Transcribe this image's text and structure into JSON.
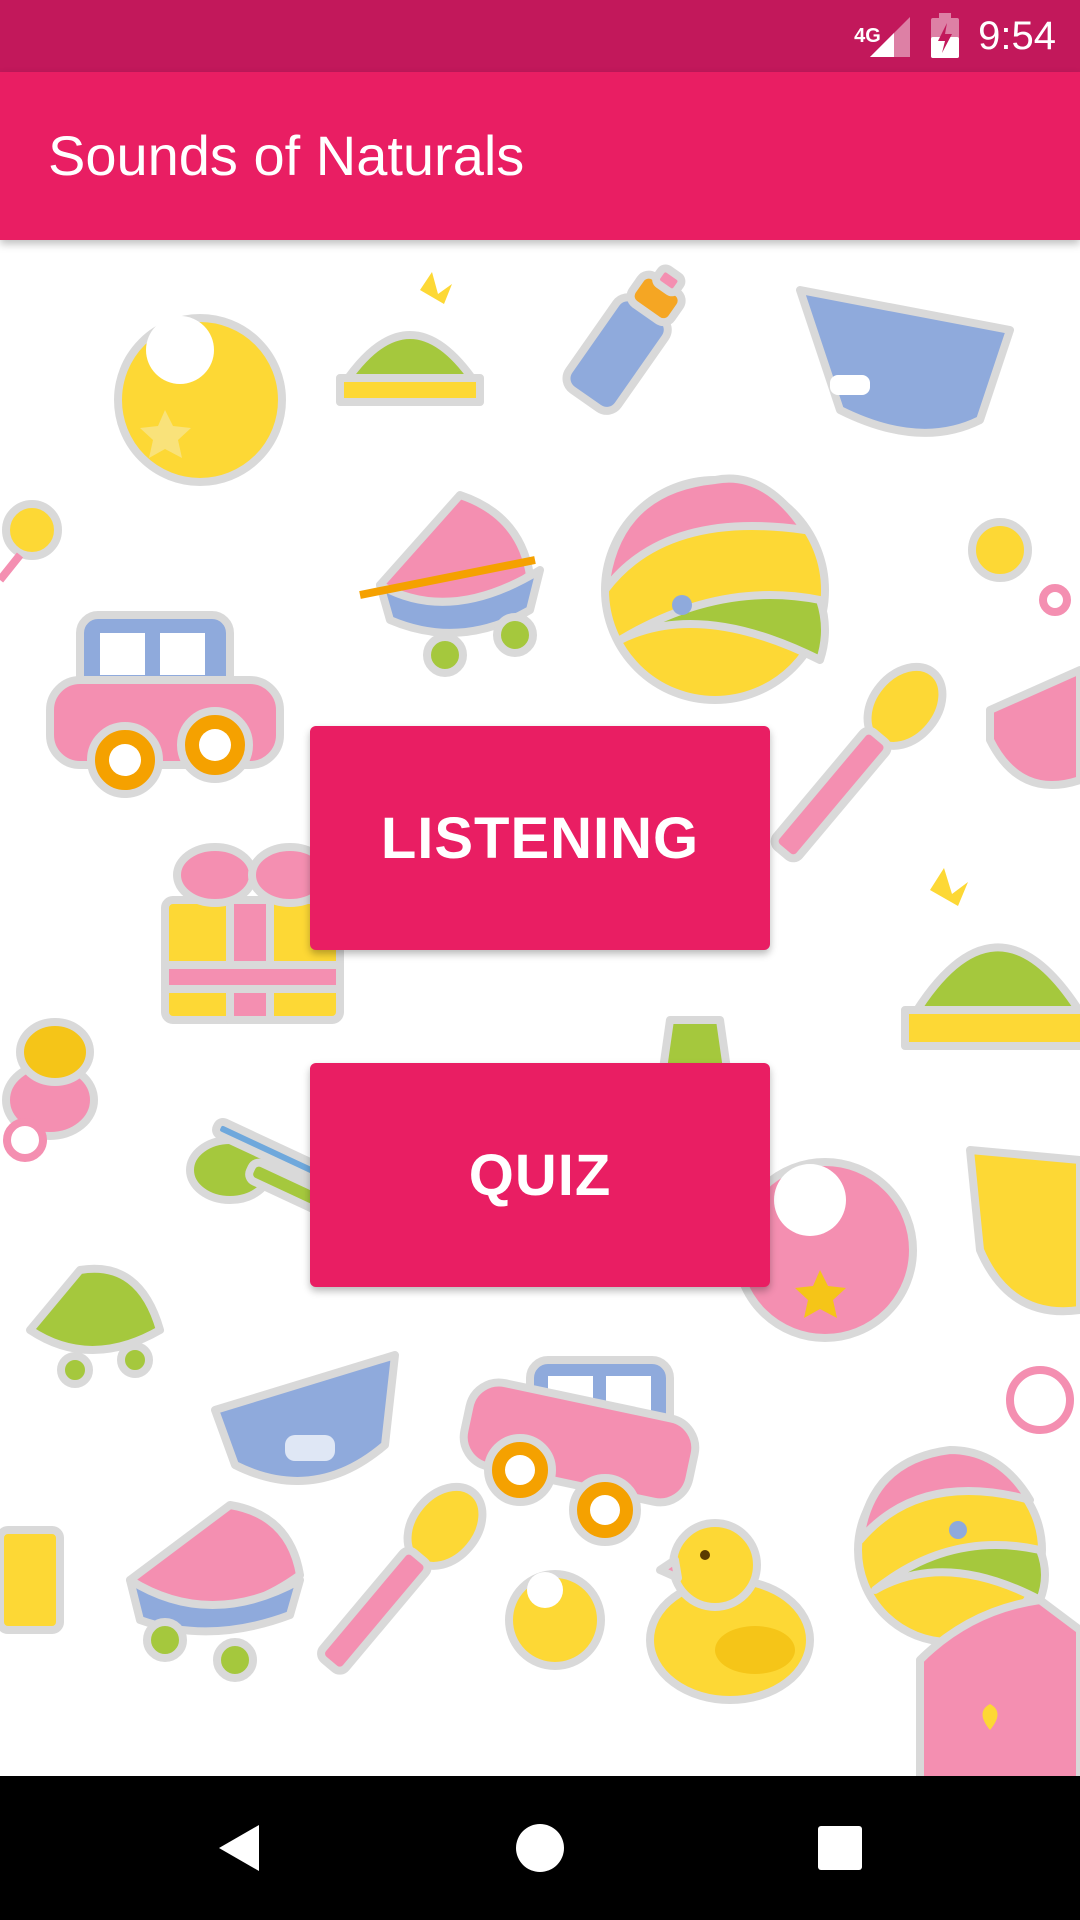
{
  "status_bar": {
    "network_type": "4G",
    "time": "9:54",
    "icons": [
      "signal-icon",
      "battery-charging-icon"
    ]
  },
  "app_bar": {
    "title": "Sounds of Naturals"
  },
  "main": {
    "buttons": [
      {
        "label": "LISTENING"
      },
      {
        "label": "QUIZ"
      }
    ],
    "background": "baby-items-pattern"
  },
  "nav_bar": {
    "icons": [
      "back-icon",
      "home-icon",
      "recents-icon"
    ]
  },
  "colors": {
    "status_bar": "#C2185B",
    "primary": "#E91E63",
    "nav_bar": "#000000",
    "pattern_pink": "#F48FB1",
    "pattern_yellow": "#FDD835",
    "pattern_blue": "#8FAADC",
    "pattern_green": "#A5C83D",
    "pattern_orange": "#F5A100"
  }
}
